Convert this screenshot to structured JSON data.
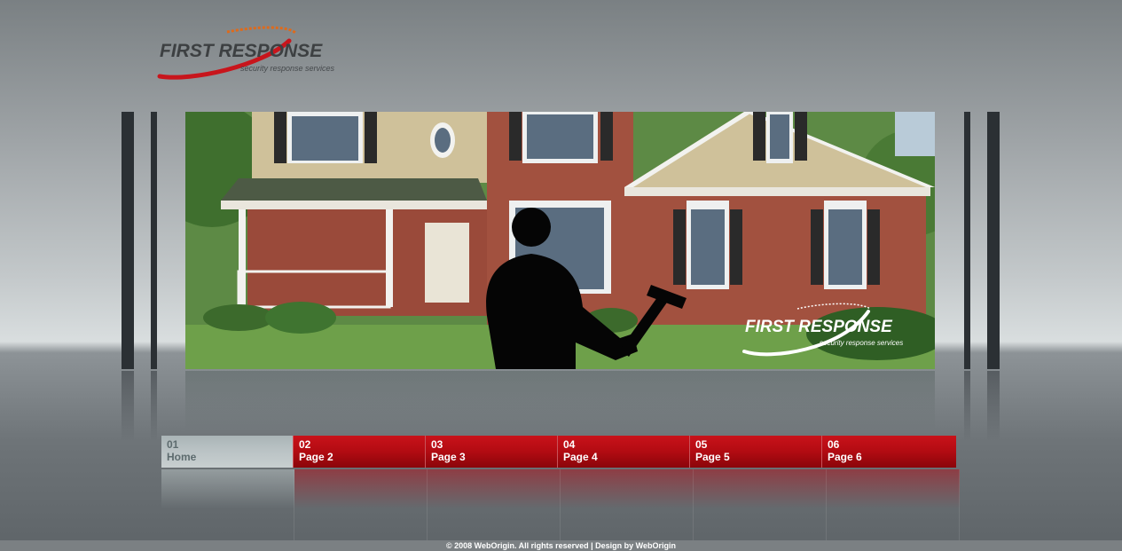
{
  "logo": {
    "title": "FIRST RESPONSE",
    "tagline": "security response services"
  },
  "banner": {
    "logo_title": "FIRST RESPONSE",
    "logo_tagline": "security response services"
  },
  "nav": {
    "items": [
      {
        "number": "01",
        "label": "Home",
        "active": true
      },
      {
        "number": "02",
        "label": "Page 2",
        "active": false
      },
      {
        "number": "03",
        "label": "Page 3",
        "active": false
      },
      {
        "number": "04",
        "label": "Page 4",
        "active": false
      },
      {
        "number": "05",
        "label": "Page 5",
        "active": false
      },
      {
        "number": "06",
        "label": "Page 6",
        "active": false
      }
    ]
  },
  "footer": {
    "text": "© 2008 WebOrigin. All rights reserved | Design by WebOrigin"
  },
  "colors": {
    "accent_red": "#b20b12",
    "active_tab": "#b8c1c3",
    "pillar": "#2b3034"
  }
}
